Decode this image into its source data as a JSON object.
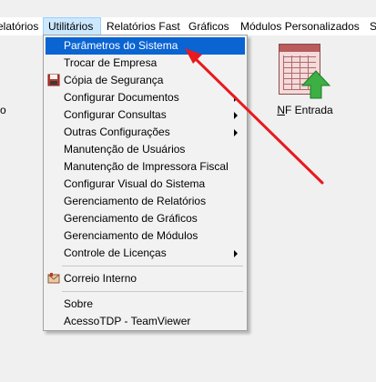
{
  "menubar": {
    "items": [
      {
        "label": "elatórios"
      },
      {
        "label": "Utilitários"
      },
      {
        "label": "Relatórios Fast"
      },
      {
        "label": "Gráficos"
      },
      {
        "label": "Módulos Personalizados"
      },
      {
        "label": "S"
      }
    ]
  },
  "side_fragment": "o",
  "desktop": {
    "nf_entrada": {
      "accel": "N",
      "rest": "F Entrada"
    }
  },
  "menu": {
    "items": [
      {
        "label": "Parâmetros do Sistema"
      },
      {
        "label": "Trocar de Empresa"
      },
      {
        "label": "Cópia de Segurança"
      },
      {
        "label": "Configurar Documentos"
      },
      {
        "label": "Configurar Consultas"
      },
      {
        "label": "Outras Configurações"
      },
      {
        "label": "Manutenção de Usuários"
      },
      {
        "label": "Manutenção de Impressora Fiscal"
      },
      {
        "label": "Configurar Visual do Sistema"
      },
      {
        "label": "Gerenciamento de Relatórios"
      },
      {
        "label": "Gerenciamento de Gráficos"
      },
      {
        "label": "Gerenciamento de Módulos"
      },
      {
        "label": "Controle de Licenças"
      },
      {
        "label": "Correio Interno"
      },
      {
        "label": "Sobre"
      },
      {
        "label": "AcessoTDP - TeamViewer"
      }
    ]
  },
  "colors": {
    "highlight": "#0a64d2",
    "menubar_active": "#cce8ff",
    "annotation_arrow": "#e8191f"
  },
  "icons": {
    "backup": "floppy-disk-icon",
    "mail": "mail-icon",
    "nf_entrada": "spreadsheet-green-arrow-icon",
    "submenu": "chevron-right-icon"
  }
}
